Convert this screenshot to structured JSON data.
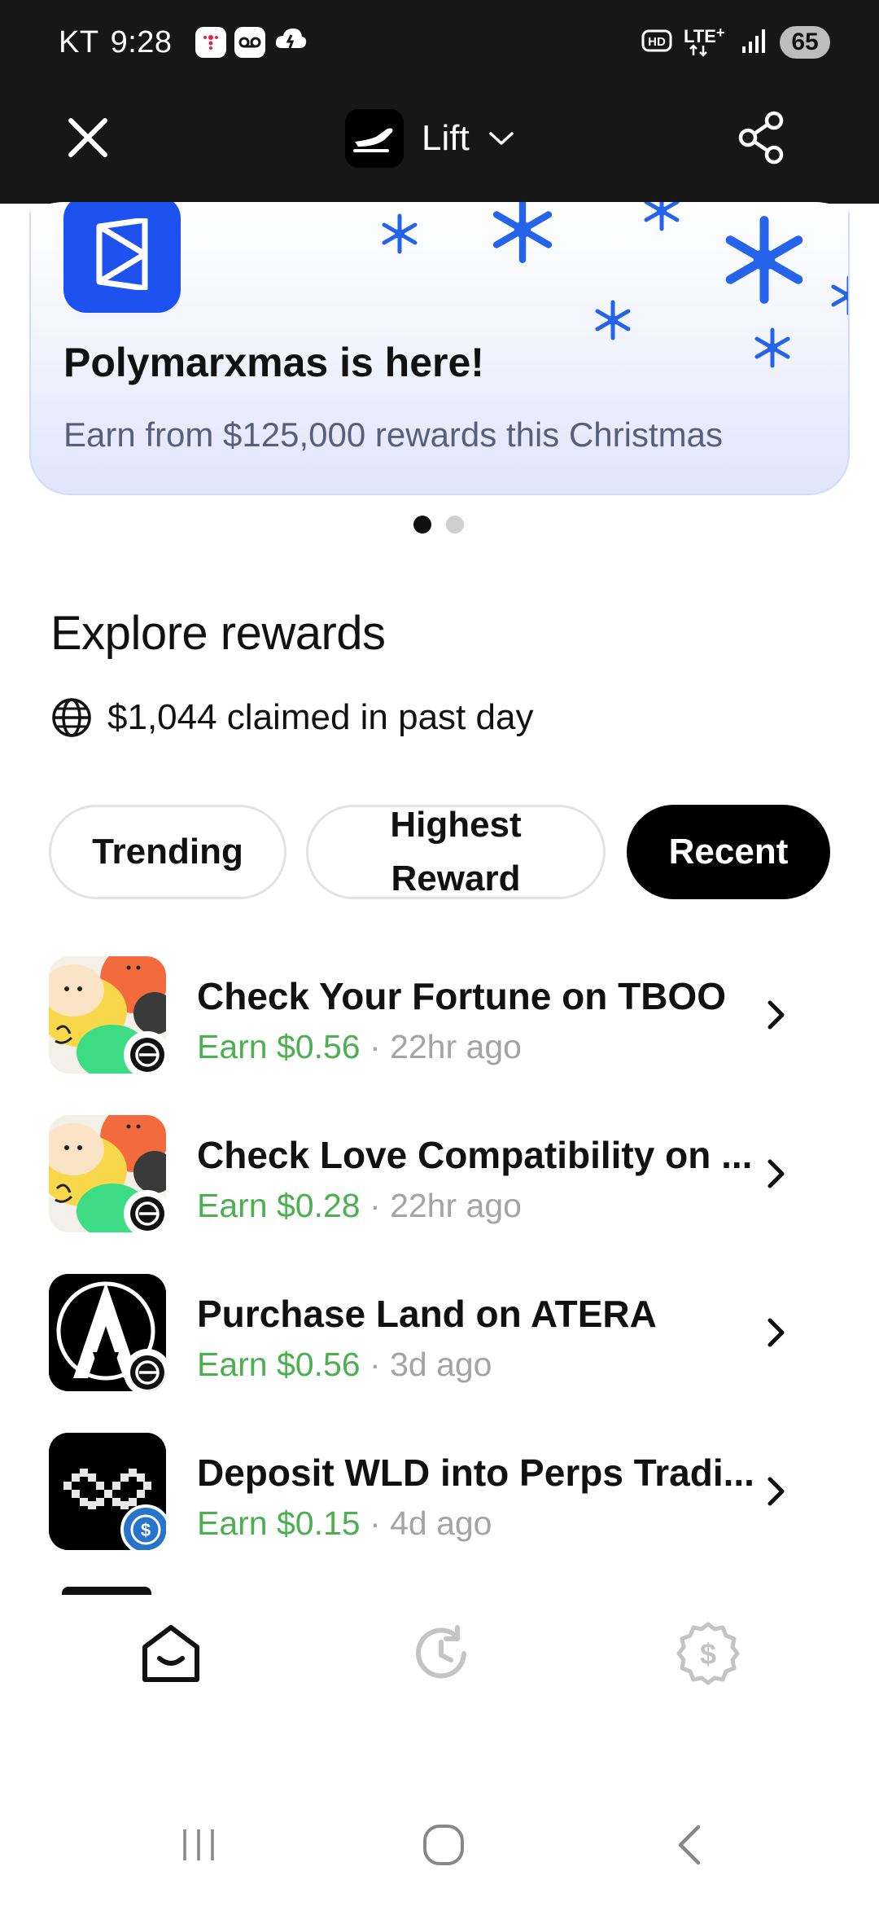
{
  "status_bar": {
    "carrier": "KT",
    "time": "9:28",
    "battery": "65",
    "network": "LTE+"
  },
  "header": {
    "title": "Lift",
    "icons": [
      "close-icon",
      "airplane-logo-icon",
      "chevron-down-icon",
      "share-icon"
    ]
  },
  "banner": {
    "title": "Polymarxmas is here!",
    "subtitle": "Earn from $125,000 rewards this Christmas",
    "accent_color": "#1d52f0",
    "page_count": 2,
    "active_page": 1
  },
  "explore": {
    "title": "Explore rewards",
    "claimed_text": "$1,044 claimed in past day"
  },
  "filters": [
    {
      "label": "Trending",
      "active": false
    },
    {
      "label": "Highest Reward",
      "active": false
    },
    {
      "label": "Recent",
      "active": true
    }
  ],
  "rewards": [
    {
      "title": "Check Your Fortune on TBOO",
      "earn": "Earn $0.56",
      "sep": "·",
      "time": "22hr ago",
      "badge": "worldcoin-icon"
    },
    {
      "title": "Check Love Compatibility on ...",
      "earn": "Earn $0.28",
      "sep": "·",
      "time": "22hr ago",
      "badge": "worldcoin-icon"
    },
    {
      "title": "Purchase Land on ATERA",
      "earn": "Earn $0.56",
      "sep": "·",
      "time": "3d ago",
      "badge": "worldcoin-icon"
    },
    {
      "title": "Deposit WLD into Perps Tradi...",
      "earn": "Earn $0.15",
      "sep": "·",
      "time": "4d ago",
      "badge": "usdc-icon"
    }
  ],
  "colors": {
    "earn_green": "#4caf50",
    "muted_gray": "#a4a4a4",
    "header_bg": "#171717"
  },
  "bottom_nav": [
    "home-icon",
    "history-icon",
    "rewards-dollar-icon"
  ],
  "system_nav": [
    "recent-apps-icon",
    "home-circle-icon",
    "back-icon"
  ]
}
